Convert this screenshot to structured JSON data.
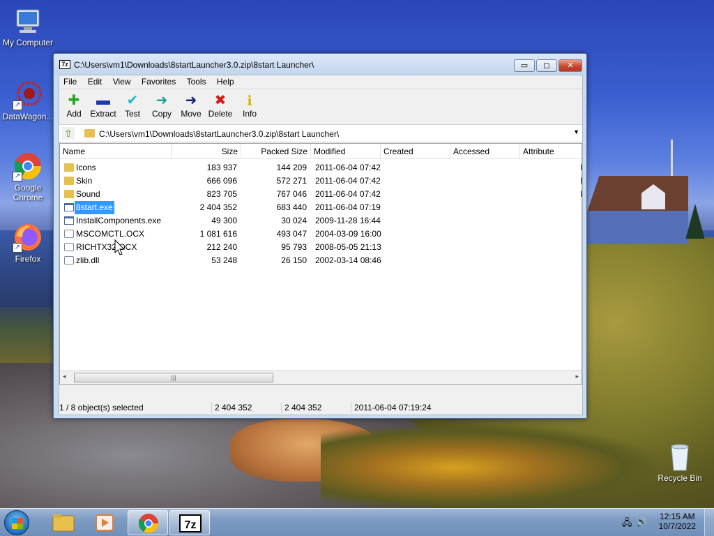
{
  "desktop": {
    "icons": [
      {
        "label": "My Computer"
      },
      {
        "label": "DataWagon..."
      },
      {
        "label": "Google Chrome"
      },
      {
        "label": "Firefox"
      },
      {
        "label": "Recycle Bin"
      }
    ]
  },
  "window": {
    "icon_text": "7z",
    "title": "C:\\Users\\vm1\\Downloads\\8startLauncher3.0.zip\\8start Launcher\\",
    "controls": {
      "minimize": "▭",
      "maximize": "◻",
      "close": "✕"
    }
  },
  "menubar": [
    "File",
    "Edit",
    "View",
    "Favorites",
    "Tools",
    "Help"
  ],
  "toolbar": [
    {
      "label": "Add",
      "icon": "plus-icon",
      "glyph": "✚",
      "color": "#22aa22"
    },
    {
      "label": "Extract",
      "icon": "minus-icon",
      "glyph": "▬",
      "color": "#1e3aa8"
    },
    {
      "label": "Test",
      "icon": "check-icon",
      "glyph": "✔",
      "color": "#22b8c8"
    },
    {
      "label": "Copy",
      "icon": "copy-arrow-icon",
      "glyph": "➜",
      "color": "#20a090"
    },
    {
      "label": "Move",
      "icon": "move-arrow-icon",
      "glyph": "➜",
      "color": "#10206a"
    },
    {
      "label": "Delete",
      "icon": "delete-x-icon",
      "glyph": "✖",
      "color": "#d81818"
    },
    {
      "label": "Info",
      "icon": "info-icon",
      "glyph": "i",
      "color": "#d8b800"
    }
  ],
  "address": {
    "path": "C:\\Users\\vm1\\Downloads\\8startLauncher3.0.zip\\8start Launcher\\",
    "dropdown": "▼",
    "up": "⇧"
  },
  "columns": [
    "Name",
    "Size",
    "Packed Size",
    "Modified",
    "Created",
    "Accessed",
    "Attribute"
  ],
  "files": [
    {
      "name": "Icons",
      "type": "folder",
      "size": "183 937",
      "packed": "144 209",
      "modified": "2011-06-04 07:42",
      "attr": "I"
    },
    {
      "name": "Skin",
      "type": "folder",
      "size": "666 096",
      "packed": "572 271",
      "modified": "2011-06-04 07:42",
      "attr": "I"
    },
    {
      "name": "Sound",
      "type": "folder",
      "size": "823 705",
      "packed": "767 046",
      "modified": "2011-06-04 07:42",
      "attr": "I"
    },
    {
      "name": "8start.exe",
      "type": "exe",
      "size": "2 404 352",
      "packed": "683 440",
      "modified": "2011-06-04 07:19",
      "attr": "",
      "selected": true
    },
    {
      "name": "InstallComponents.exe",
      "type": "exe",
      "size": "49 300",
      "packed": "30 024",
      "modified": "2009-11-28 16:44",
      "attr": ""
    },
    {
      "name": "MSCOMCTL.OCX",
      "type": "dll",
      "size": "1 081 616",
      "packed": "493 047",
      "modified": "2004-03-09 16:00",
      "attr": ""
    },
    {
      "name": "RICHTX32.OCX",
      "type": "dll",
      "size": "212 240",
      "packed": "95 793",
      "modified": "2008-05-05 21:13",
      "attr": ""
    },
    {
      "name": "zlib.dll",
      "type": "dll",
      "size": "53 248",
      "packed": "26 150",
      "modified": "2002-03-14 08:46",
      "attr": ""
    }
  ],
  "scrollbar": {
    "left": "◂",
    "right": "▸",
    "grip": "|||"
  },
  "status": {
    "selection": "1 / 8 object(s) selected",
    "size": "2 404 352",
    "packed": "2 404 352",
    "modified": "2011-06-04 07:19:24"
  },
  "taskbar": {
    "time": "12:15 AM",
    "date": "10/7/2022",
    "tray_network": "🖧",
    "tray_volume": "🔊"
  }
}
